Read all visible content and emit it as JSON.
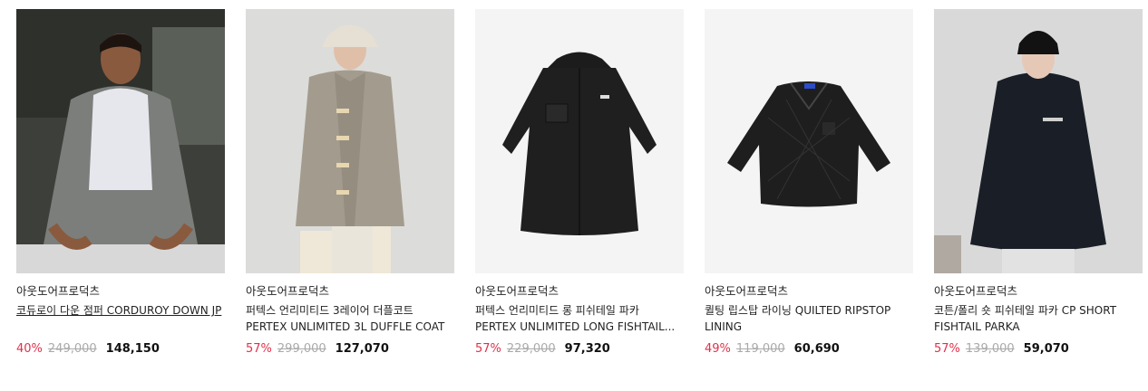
{
  "colors": {
    "discount": "#e0314b",
    "original_price": "#aaaaaa",
    "sale_price": "#111111"
  },
  "products": [
    {
      "brand": "아웃도어프로덕츠",
      "name": "코듀로이 다운 점퍼 CORDUROY DOWN JP",
      "discount": "40%",
      "original_price": "249,000",
      "sale_price": "148,150",
      "image": "model-corduroy-down-jacket"
    },
    {
      "brand": "아웃도어프로덕츠",
      "name": "퍼텍스 언리미티드 3레이어 더플코트 PERTEX UNLIMITED 3L DUFFLE COAT",
      "discount": "57%",
      "original_price": "299,000",
      "sale_price": "127,070",
      "image": "model-duffle-coat"
    },
    {
      "brand": "아웃도어프로덕츠",
      "name": "퍼텍스 언리미티드 롱 피쉬테일 파카 PERTEX UNLIMITED LONG FISHTAIL...",
      "discount": "57%",
      "original_price": "229,000",
      "sale_price": "97,320",
      "image": "black-fishtail-parka"
    },
    {
      "brand": "아웃도어프로덕츠",
      "name": "퀼팅 립스탑 라이닝 QUILTED RIPSTOP LINING",
      "discount": "49%",
      "original_price": "119,000",
      "sale_price": "60,690",
      "image": "black-quilted-liner"
    },
    {
      "brand": "아웃도어프로덕츠",
      "name": "코튼/폴리 숏 피쉬테일 파카 CP SHORT FISHTAIL PARKA",
      "discount": "57%",
      "original_price": "139,000",
      "sale_price": "59,070",
      "image": "model-short-parka"
    }
  ]
}
